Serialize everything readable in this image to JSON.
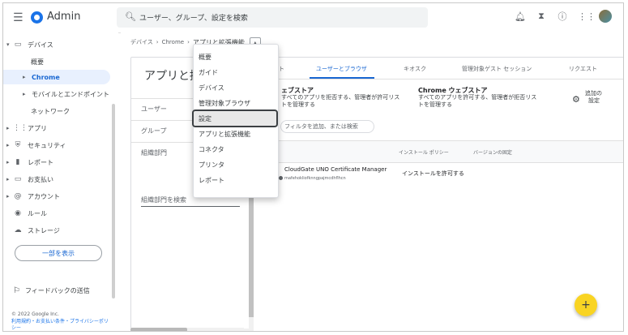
{
  "app": {
    "title": "Admin"
  },
  "search": {
    "placeholder": "ユーザー、グループ、設定を検索"
  },
  "top_icons": [
    "bell-icon",
    "hourglass-icon",
    "help-icon",
    "apps-grid-icon",
    "avatar"
  ],
  "sidebar": {
    "items": [
      {
        "label": "デバイス",
        "icon": "devices-icon",
        "caret": "▾"
      },
      {
        "label": "概要"
      },
      {
        "label": "Chrome",
        "caret": "▸",
        "active": true
      },
      {
        "label": "モバイルとエンドポイント",
        "caret": "▸"
      },
      {
        "label": "ネットワーク"
      },
      {
        "label": "アプリ",
        "icon": "apps-icon",
        "caret": "▸"
      },
      {
        "label": "セキュリティ",
        "icon": "shield-icon",
        "caret": "▸"
      },
      {
        "label": "レポート",
        "icon": "chart-icon",
        "caret": "▸"
      },
      {
        "label": "お支払い",
        "icon": "billing-icon",
        "caret": "▸"
      },
      {
        "label": "アカウント",
        "icon": "at-icon",
        "caret": "▸"
      },
      {
        "label": "ルール",
        "icon": "rules-icon"
      },
      {
        "label": "ストレージ",
        "icon": "cloud-icon"
      }
    ],
    "show_more": "一部を表示",
    "feedback": "フィードバックの送信",
    "copyright": "© 2022 Google Inc.",
    "links": "利用規約・お支払い条件・プライバシーポリシー"
  },
  "breadcrumb": {
    "items": [
      "デバイス",
      "Chrome"
    ],
    "current": "アプリと拡張機能"
  },
  "card": {
    "title": "アプリと拡",
    "left_panel": {
      "users": "ユーザー",
      "groups": "グループ",
      "org_units": "組織部門",
      "search": "組織部門を検索"
    },
    "tabs": [
      "ト",
      "ユーザーとブラウザ",
      "キオスク",
      "管理対象ゲスト セッション",
      "リクエスト"
    ],
    "store_left": {
      "title": "ェブストア",
      "line1": "すべてのアプリを拒否する、管理者が許可リス",
      "line2": "トを管理する"
    },
    "store_right": {
      "title": "Chrome ウェブストア",
      "line1": "すべてのアプリを許可する、管理者が拒否リス",
      "line2": "トを管理する"
    },
    "additional_settings_1": "追加の",
    "additional_settings_2": "設定",
    "filter_placeholder": "フィルタを追加、または検索",
    "table": {
      "headers": [
        "インストール ポリシー",
        "バージョンの固定"
      ],
      "rows": [
        {
          "name": "CloudGate UNO Certificate Manager",
          "id": "mafehokliofknngpajmcdhflhcn",
          "policy": "インストールを許可する"
        }
      ]
    }
  },
  "dropdown": {
    "items": [
      "概要",
      "ガイド",
      "デバイス",
      "管理対象ブラウザ",
      "設定",
      "アプリと拡張機能",
      "コネクタ",
      "プリンタ",
      "レポート"
    ],
    "highlighted_index": 4
  },
  "fab": {
    "label": "+"
  }
}
